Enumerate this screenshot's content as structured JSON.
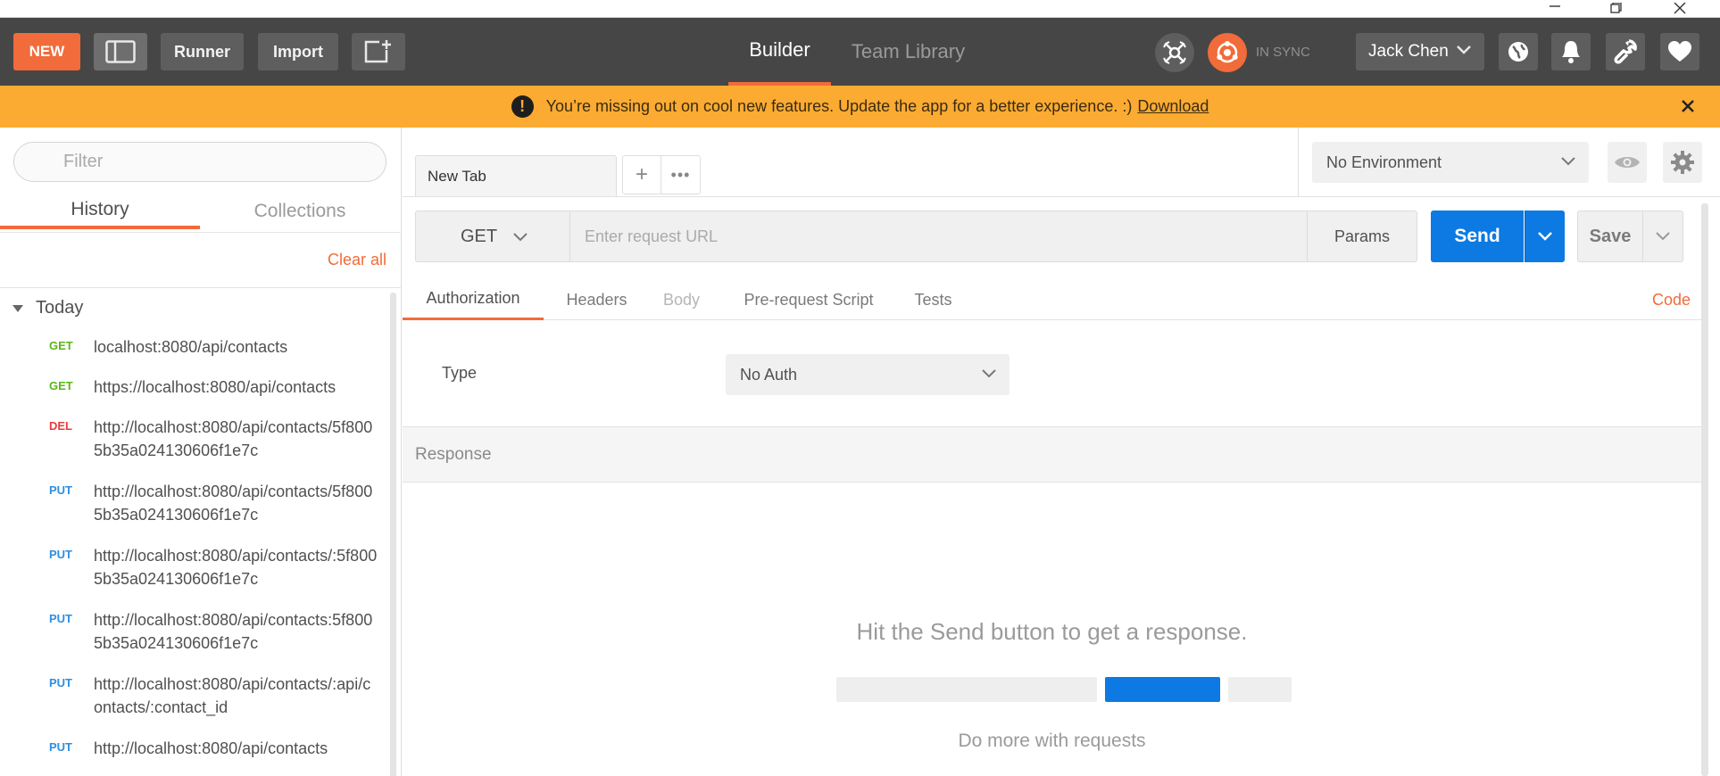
{
  "window": {
    "controls": [
      "minimize",
      "maximize",
      "close"
    ]
  },
  "topnav": {
    "new_label": "NEW",
    "runner_label": "Runner",
    "import_label": "Import",
    "tabs": [
      {
        "label": "Builder",
        "active": true
      },
      {
        "label": "Team Library",
        "active": false
      }
    ],
    "sync_status": "IN SYNC",
    "user_name": "Jack Chen",
    "accent": "#f26b3a",
    "icons": [
      "sidebar-toggle-icon",
      "new-window-icon",
      "interceptor-icon",
      "sync-icon",
      "globe-icon",
      "bell-icon",
      "wrench-icon",
      "heart-icon"
    ]
  },
  "banner": {
    "message": "You’re missing out on cool new features. Update the app for a better experience. :)",
    "link": "Download",
    "color": "#fbab32"
  },
  "sidebar": {
    "filter_placeholder": "Filter",
    "tabs": [
      {
        "label": "History",
        "active": true
      },
      {
        "label": "Collections",
        "active": false
      }
    ],
    "clear_all": "Clear all",
    "group_label": "Today",
    "history": [
      {
        "method": "GET",
        "url": "localhost:8080/api/contacts"
      },
      {
        "method": "GET",
        "url": "https://localhost:8080/api/contacts"
      },
      {
        "method": "DEL",
        "url": "http://localhost:8080/api/contacts/​5f8005b35a024130606f1e7c"
      },
      {
        "method": "PUT",
        "url": "http://localhost:8080/api/contacts/​5f8005b35a024130606f1e7c"
      },
      {
        "method": "PUT",
        "url": "http://localhost:8080/api/contacts/:​5f8005b35a024130606f1e7c"
      },
      {
        "method": "PUT",
        "url": "http://localhost:8080/api/contacts:​5f8005b35a024130606f1e7c"
      },
      {
        "method": "PUT",
        "url": "http://localhost:8080/api/contacts/:​api/contacts/:contact_id"
      },
      {
        "method": "PUT",
        "url": "http://localhost:8080/api/contacts"
      }
    ],
    "method_colors": {
      "GET": "#5bb61a",
      "DEL": "#ea3c3c",
      "PUT": "#2f8fe0"
    }
  },
  "request": {
    "tab_label": "New Tab",
    "add_tab": "+",
    "more_tabs": "•••",
    "environment": "No Environment",
    "method": "GET",
    "url_placeholder": "Enter request URL",
    "params_label": "Params",
    "send_label": "Send",
    "save_label": "Save",
    "subtabs": [
      {
        "label": "Authorization",
        "state": "active"
      },
      {
        "label": "Headers",
        "state": "normal"
      },
      {
        "label": "Body",
        "state": "disabled"
      },
      {
        "label": "Pre-request Script",
        "state": "normal"
      },
      {
        "label": "Tests",
        "state": "normal"
      }
    ],
    "code_label": "Code",
    "auth_type_label": "Type",
    "auth_type_value": "No Auth"
  },
  "response": {
    "label": "Response",
    "hint": "Hit the Send button to get a response.",
    "more": "Do more with requests"
  }
}
